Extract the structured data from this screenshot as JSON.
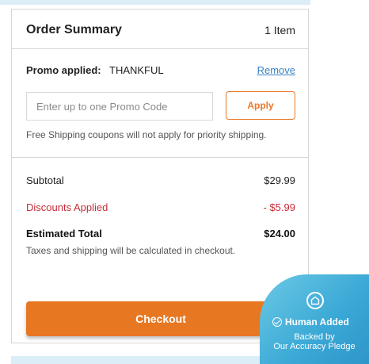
{
  "summary": {
    "title": "Order Summary",
    "item_count": "1 Item"
  },
  "promo": {
    "applied_label": "Promo applied:",
    "code": "THANKFUL",
    "remove_label": "Remove",
    "input_placeholder": "Enter up to one Promo Code",
    "input_value": "",
    "apply_label": "Apply",
    "shipping_note": "Free Shipping coupons will not apply for priority shipping."
  },
  "totals": {
    "subtotal_label": "Subtotal",
    "subtotal_value": "$29.99",
    "discounts_label": "Discounts Applied",
    "discounts_value": "- $5.99",
    "estimated_label": "Estimated Total",
    "estimated_value": "$24.00",
    "tax_note": "Taxes and shipping will be calculated in checkout."
  },
  "checkout": {
    "label": "Checkout"
  },
  "badge": {
    "icon": "shield-house-icon",
    "status": "Human Added",
    "backed_by": "Backed by",
    "pledge_name": "Our Accuracy Pledge"
  },
  "colors": {
    "accent": "#e87722",
    "discount": "#c62d3b",
    "link": "#3b82c4",
    "badge": "#3aa8d6"
  }
}
